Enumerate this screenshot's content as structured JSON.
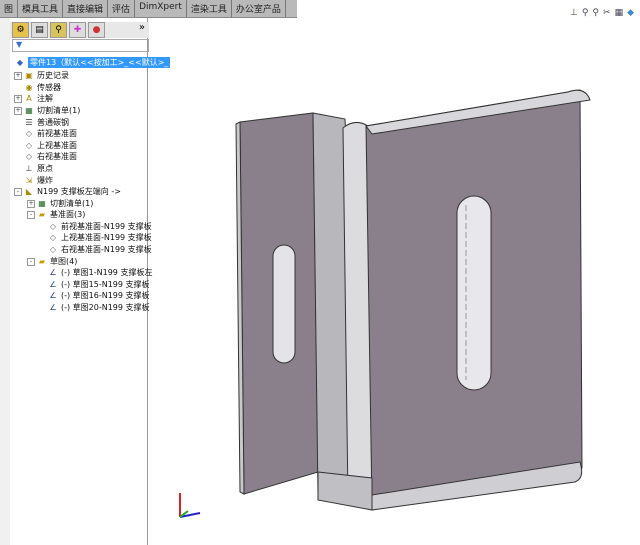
{
  "tabs": [
    "图",
    "模具工具",
    "直接编辑",
    "评估",
    "DimXpert",
    "渲染工具",
    "办公室产品"
  ],
  "feature_tree": {
    "filter_icon": "filter-icon",
    "more_label": "»",
    "rows": [
      {
        "label": "零件13（默认<<按加工>_<<默认>_",
        "level": 0,
        "selected": true,
        "icon": "part-icon"
      },
      {
        "label": "历史记录",
        "level": 1,
        "expander": "+",
        "icon": "history-icon"
      },
      {
        "label": "传感器",
        "level": 1,
        "icon": "sensor-icon"
      },
      {
        "label": "注解",
        "level": 1,
        "expander": "+",
        "icon": "annotation-icon"
      },
      {
        "label": "切割清单(1)",
        "level": 1,
        "expander": "+",
        "icon": "cutlist-icon"
      },
      {
        "label": "普通碳钢",
        "level": 1,
        "icon": "material-icon"
      },
      {
        "label": "前视基准面",
        "level": 1,
        "icon": "plane-icon"
      },
      {
        "label": "上视基准面",
        "level": 1,
        "icon": "plane-icon"
      },
      {
        "label": "右视基准面",
        "level": 1,
        "icon": "plane-icon"
      },
      {
        "label": "原点",
        "level": 1,
        "icon": "origin-icon"
      },
      {
        "label": "爆炸",
        "level": 1,
        "icon": "explode-icon"
      },
      {
        "label": "N199 支撑板左端向 ->",
        "level": 1,
        "expander": "-",
        "icon": "sheetmetal-icon"
      },
      {
        "label": "切割清单(1)",
        "level": 2,
        "expander": "+",
        "icon": "cutlist-icon"
      },
      {
        "label": "基准面(3)",
        "level": 2,
        "expander": "-",
        "icon": "folder-icon"
      },
      {
        "label": "前视基准面-N199 支撑板",
        "level": 3,
        "icon": "plane-icon"
      },
      {
        "label": "上视基准面-N199 支撑板",
        "level": 3,
        "icon": "plane-icon"
      },
      {
        "label": "右视基准面-N199 支撑板",
        "level": 3,
        "icon": "plane-icon"
      },
      {
        "label": "草图(4)",
        "level": 2,
        "expander": "-",
        "icon": "folder-icon"
      },
      {
        "label": "(-) 草图1-N199 支撑板左",
        "level": 3,
        "icon": "sketch-icon"
      },
      {
        "label": "(-) 草图15-N199 支撑板",
        "level": 3,
        "icon": "sketch-icon"
      },
      {
        "label": "(-) 草图16-N199 支撑板",
        "level": 3,
        "icon": "sketch-icon"
      },
      {
        "label": "(-) 草图20-N199 支撑板",
        "level": 3,
        "icon": "sketch-icon"
      }
    ]
  },
  "colors": {
    "selection": "#3399ff",
    "part_face": "#8a7f8c",
    "part_edge": "#3a3a3a"
  }
}
